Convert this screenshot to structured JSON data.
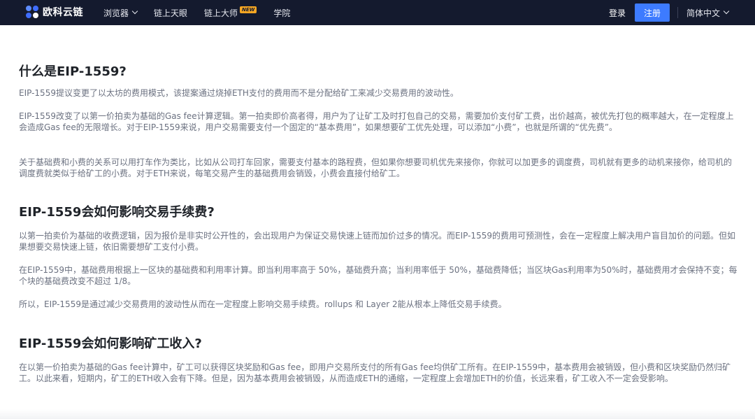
{
  "header": {
    "logo_text": "欧科云链",
    "nav": [
      {
        "label": "浏览器",
        "has_dropdown": true
      },
      {
        "label": "链上天眼",
        "has_dropdown": false
      },
      {
        "label": "链上大师",
        "badge": "NEW"
      },
      {
        "label": "学院",
        "has_dropdown": false
      }
    ],
    "login_label": "登录",
    "register_label": "注册",
    "language_label": "简体中文",
    "colors": {
      "bar_background": "#141a2e",
      "register_button": "#3d7bff",
      "badge": "#f5a623"
    }
  },
  "article": {
    "sections": [
      {
        "heading": "什么是EIP-1559?",
        "paragraphs": [
          "EIP-1559提议变更了以太坊的费用模式，该提案通过烧掉ETH支付的费用而不是分配给矿工来减少交易费用的波动性。",
          "EIP-1559改变了以第一价拍卖为基础的Gas fee计算逻辑。第一拍卖即价高者得，用户为了让矿工及时打包自己的交易，需要加价支付矿工费，出价越高，被优先打包的概率越大，在一定程度上会造成Gas fee的无限增长。对于EIP-1559来说，用户交易需要支付一个固定的“基本费用”，如果想要矿工优先处理，可以添加“小费”，也就是所谓的“优先费”。",
          "关于基础费和小费的关系可以用打车作为类比，比如从公司打车回家，需要支付基本的路程费，但如果你想要司机优先来接你，你就可以加更多的调度费，司机就有更多的动机来接你，给司机的调度费就类似于给矿工的小费。对于ETH来说，每笔交易产生的基础费用会销毁，小费会直接付给矿工。"
        ]
      },
      {
        "heading": "EIP-1559会如何影响交易手续费?",
        "paragraphs": [
          "以第一拍卖价为基础的收费逻辑，因为报价是非实时公开性的，会出现用户为保证交易快速上链而加价过多的情况。而EIP-1559的费用可预测性，会在一定程度上解决用户盲目加价的问题。但如果想要交易快速上链，依旧需要想矿工支付小费。",
          "在EIP-1559中，基础费用根据上一区块的基础费和利用率计算。即当利用率高于 50%，基础费升高；当利用率低于 50%，基础费降低；当区块Gas利用率为50%时，基础费用才会保持不变；每个块的基础费改变不超过 1/8。",
          "所以，EIP-1559是通过减少交易费用的波动性从而在一定程度上影响交易手续费。rollups 和 Layer 2能从根本上降低交易手续费。"
        ]
      },
      {
        "heading": "EIP-1559会如何影响矿工收入?",
        "paragraphs": [
          "在以第一价拍卖为基础的Gas fee计算中，矿工可以获得区块奖励和Gas fee，即用户交易所支付的所有Gas fee均供矿工所有。在EIP-1559中，基本费用会被销毁，但小费和区块奖励仍然归矿工。以此来看，短期内，矿工的ETH收入会有下降。但是，因为基本费用会被销毁，从而造成ETH的通缩，一定程度上会增加ETH的价值，长远来看，矿工收入不一定会受影响。"
        ]
      }
    ]
  }
}
